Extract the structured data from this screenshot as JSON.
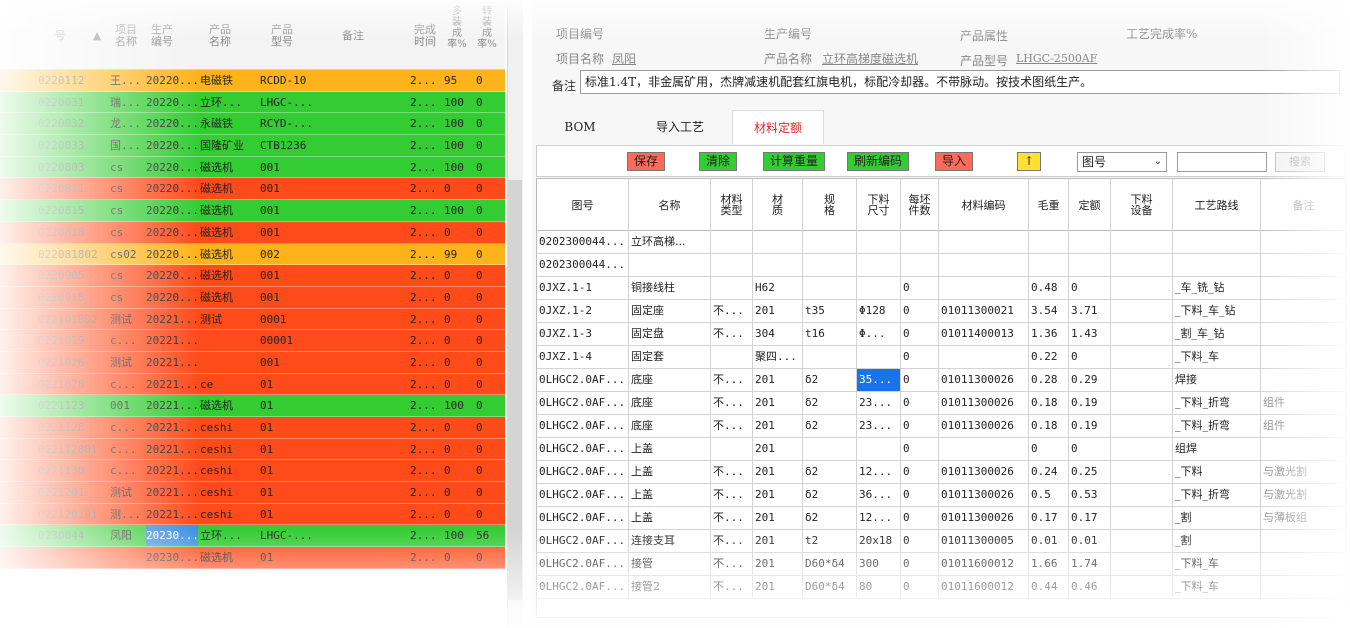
{
  "left_list": {
    "headers": [
      "号",
      "项目\n名称",
      "生产\n编号",
      "产品\n名称",
      "产品\n型号",
      "备注",
      "完成\n时间",
      "多\n装\n成\n率%",
      "转\n装\n成\n率%"
    ],
    "rows": [
      {
        "code": "0220112",
        "name": "王...",
        "prod_no": "20220...",
        "product": "电磁铁",
        "model": "RCDD-10",
        "remark": "",
        "time": "2...",
        "r1": "95",
        "r2": "0",
        "color": "#ffb31a"
      },
      {
        "code": "0220031",
        "name": "瑞...",
        "prod_no": "20220...",
        "product": "立环...",
        "model": "LHGC-...",
        "remark": "",
        "time": "2...",
        "r1": "100",
        "r2": "0",
        "color": "#33cc33"
      },
      {
        "code": "0220032",
        "name": "龙...",
        "prod_no": "20220...",
        "product": "永磁铁",
        "model": "RCYD-...",
        "remark": "",
        "time": "2...",
        "r1": "100",
        "r2": "0",
        "color": "#33cc33"
      },
      {
        "code": "0220033",
        "name": "国...",
        "prod_no": "20220...",
        "product": "国隆矿业",
        "model": "CTB1236",
        "remark": "",
        "time": "2...",
        "r1": "100",
        "r2": "0",
        "color": "#33cc33"
      },
      {
        "code": "0220803",
        "name": "cs",
        "prod_no": "20220...",
        "product": "磁选机",
        "model": "001",
        "remark": "",
        "time": "2...",
        "r1": "100",
        "r2": "0",
        "color": "#33cc33"
      },
      {
        "code": "0220811",
        "name": "cs",
        "prod_no": "20220...",
        "product": "磁选机",
        "model": "001",
        "remark": "",
        "time": "2...",
        "r1": "0",
        "r2": "0",
        "color": "#ff4a1a"
      },
      {
        "code": "0220815",
        "name": "cs",
        "prod_no": "20220...",
        "product": "磁选机",
        "model": "001",
        "remark": "",
        "time": "2...",
        "r1": "100",
        "r2": "0",
        "color": "#33cc33"
      },
      {
        "code": "0220818",
        "name": "cs",
        "prod_no": "20220...",
        "product": "磁选机",
        "model": "001",
        "remark": "",
        "time": "2...",
        "r1": "0",
        "r2": "0",
        "color": "#ff4a1a"
      },
      {
        "code": "022081802",
        "name": "cs02",
        "prod_no": "20220...",
        "product": "磁选机",
        "model": "002",
        "remark": "",
        "time": "2...",
        "r1": "99",
        "r2": "0",
        "color": "#ffb31a"
      },
      {
        "code": "0220905",
        "name": "cs",
        "prod_no": "20220...",
        "product": "磁选机",
        "model": "001",
        "remark": "",
        "time": "2...",
        "r1": "0",
        "r2": "0",
        "color": "#ff4a1a"
      },
      {
        "code": "0220915",
        "name": "cs",
        "prod_no": "20220...",
        "product": "磁选机",
        "model": "001",
        "remark": "",
        "time": "2...",
        "r1": "0",
        "r2": "0",
        "color": "#ff4a1a"
      },
      {
        "code": "022101802",
        "name": "测试",
        "prod_no": "20221...",
        "product": "测试",
        "model": "0001",
        "remark": "",
        "time": "2...",
        "r1": "0",
        "r2": "0",
        "color": "#ff4a1a"
      },
      {
        "code": "0221019",
        "name": "c...",
        "prod_no": "20221...",
        "product": "",
        "model": "00001",
        "remark": "",
        "time": "2...",
        "r1": "0",
        "r2": "0",
        "color": "#ff4a1a"
      },
      {
        "code": "0221026",
        "name": "测试",
        "prod_no": "20221...",
        "product": "",
        "model": "001",
        "remark": "",
        "time": "2...",
        "r1": "0",
        "r2": "0",
        "color": "#ff4a1a"
      },
      {
        "code": "0221028",
        "name": "c...",
        "prod_no": "20221...",
        "product": "ce",
        "model": "01",
        "remark": "",
        "time": "2...",
        "r1": "0",
        "r2": "0",
        "color": "#ff4a1a"
      },
      {
        "code": "0221123",
        "name": "001",
        "prod_no": "20221...",
        "product": "磁选机",
        "model": "01",
        "remark": "",
        "time": "2...",
        "r1": "100",
        "r2": "0",
        "color": "#33cc33"
      },
      {
        "code": "0221128",
        "name": "c...",
        "prod_no": "20221...",
        "product": "ceshi",
        "model": "01",
        "remark": "",
        "time": "2...",
        "r1": "0",
        "r2": "0",
        "color": "#ff4a1a"
      },
      {
        "code": "022112801",
        "name": "c...",
        "prod_no": "20221...",
        "product": "ceshi",
        "model": "01",
        "remark": "",
        "time": "2...",
        "r1": "0",
        "r2": "0",
        "color": "#ff4a1a"
      },
      {
        "code": "0221130",
        "name": "c...",
        "prod_no": "20221...",
        "product": "ceshi",
        "model": "01",
        "remark": "",
        "time": "2...",
        "r1": "0",
        "r2": "0",
        "color": "#ff4a1a"
      },
      {
        "code": "0221201",
        "name": "测试",
        "prod_no": "20221...",
        "product": "ceshi",
        "model": "01",
        "remark": "",
        "time": "2...",
        "r1": "0",
        "r2": "0",
        "color": "#ff4a1a"
      },
      {
        "code": "022120101",
        "name": "测...",
        "prod_no": "20221...",
        "product": "ceshi",
        "model": "01",
        "remark": "",
        "time": "2...",
        "r1": "0",
        "r2": "0",
        "color": "#ff4a1a"
      },
      {
        "code": "0230044",
        "name": "凤阳",
        "prod_no": "20230...",
        "product": "立环...",
        "model": "LHGC-...",
        "remark": "",
        "time": "2...",
        "r1": "100",
        "r2": "56",
        "color": "#33cc33",
        "selected": true
      },
      {
        "code": "",
        "name": "",
        "prod_no": "20230...",
        "product": "磁选机",
        "model": "01",
        "remark": "",
        "time": "2...",
        "r1": "0",
        "r2": "0",
        "color": "#ff4a1a"
      }
    ]
  },
  "header_info": {
    "project_no_label": "项目编号",
    "project_name_label": "项目名称",
    "project_name": "凤阳",
    "prod_no_label": "生产编号",
    "product_name_label": "产品名称",
    "product_name": "立环高梯度磁选机",
    "product_attr_label": "产品属性",
    "product_model_label": "产品型号",
    "product_model": "LHGC-2500AF",
    "process_rate_label": "工艺完成率%"
  },
  "remark": {
    "label": "备注",
    "text": "标准1.4T，非金属矿用，杰牌减速机配套红旗电机，标配冷却器。不带脉动。按技术图纸生产。"
  },
  "tabs": [
    {
      "label": "BOM",
      "active": false
    },
    {
      "label": "导入工艺",
      "active": false
    },
    {
      "label": "材料定额",
      "active": true
    }
  ],
  "toolbar": {
    "save": "保存",
    "clear": "清除",
    "calc_weight": "计算重量",
    "refresh_code": "刷新编码",
    "import": "导入",
    "up_arrow": "↑",
    "field_select": "图号",
    "search": "搜索"
  },
  "grid": {
    "headers": [
      "图号",
      "名称",
      "材料\n类型",
      "材\n质",
      "规\n格",
      "下料\n尺寸",
      "每坯\n件数",
      "材料编码",
      "毛重",
      "定额",
      "下料\n设备",
      "工艺路线",
      "备注"
    ],
    "rows": [
      [
        "0202300044...",
        "立环高梯...",
        "",
        "",
        "",
        "",
        "",
        "",
        "",
        "",
        "",
        "",
        ""
      ],
      [
        "0202300044...",
        "",
        "",
        "",
        "",
        "",
        "",
        "",
        "",
        "",
        "",
        "",
        ""
      ],
      [
        "0JXZ.1-1",
        "铜接线柱",
        "",
        "H62",
        "",
        "",
        "0",
        "",
        "0.48",
        "0",
        "",
        "_车_铣_钻",
        ""
      ],
      [
        "0JXZ.1-2",
        "固定座",
        "不...",
        "201",
        "t35",
        "Φ128",
        "0",
        "01011300021",
        "3.54",
        "3.71",
        "",
        "_下料_车_钻",
        ""
      ],
      [
        "0JXZ.1-3",
        "固定盘",
        "不...",
        "304",
        "t16",
        "Φ...",
        "0",
        "01011400013",
        "1.36",
        "1.43",
        "",
        "_割_车_钻",
        ""
      ],
      [
        "0JXZ.1-4",
        "固定套",
        "",
        "聚四...",
        "",
        "",
        "0",
        "",
        "0.22",
        "0",
        "",
        "_下料_车",
        ""
      ],
      [
        "0LHGC2.0AF...",
        "底座",
        "不...",
        "201",
        "δ2",
        "35...",
        "0",
        "01011300026",
        "0.28",
        "0.29",
        "",
        "焊接",
        ""
      ],
      [
        "0LHGC2.0AF...",
        "底座",
        "不...",
        "201",
        "δ2",
        "23...",
        "0",
        "01011300026",
        "0.18",
        "0.19",
        "",
        "_下料_折弯",
        "组件"
      ],
      [
        "0LHGC2.0AF...",
        "底座",
        "不...",
        "201",
        "δ2",
        "23...",
        "0",
        "01011300026",
        "0.18",
        "0.19",
        "",
        "_下料_折弯",
        "组件"
      ],
      [
        "0LHGC2.0AF...",
        "上盖",
        "",
        "201",
        "",
        "",
        "0",
        "",
        "0",
        "0",
        "",
        "组焊",
        ""
      ],
      [
        "0LHGC2.0AF...",
        "上盖",
        "不...",
        "201",
        "δ2",
        "12...",
        "0",
        "01011300026",
        "0.24",
        "0.25",
        "",
        "_下料",
        "与激光割"
      ],
      [
        "0LHGC2.0AF...",
        "上盖",
        "不...",
        "201",
        "δ2",
        "36...",
        "0",
        "01011300026",
        "0.5",
        "0.53",
        "",
        "_下料_折弯",
        "与激光割"
      ],
      [
        "0LHGC2.0AF...",
        "上盖",
        "不...",
        "201",
        "δ2",
        "12...",
        "0",
        "01011300026",
        "0.17",
        "0.17",
        "",
        "_割",
        "与薄板组"
      ],
      [
        "0LHGC2.0AF...",
        "连接支耳",
        "不...",
        "201",
        "t2",
        "20x18",
        "0",
        "01011300005",
        "0.01",
        "0.01",
        "",
        "_割",
        ""
      ],
      [
        "0LHGC2.0AF...",
        "接管",
        "不...",
        "201",
        "D60*δ4",
        "300",
        "0",
        "01011600012",
        "1.66",
        "1.74",
        "",
        "_下料_车",
        ""
      ],
      [
        "0LHGC2.0AF...",
        "接管2",
        "不...",
        "201",
        "D60*δ4",
        "80",
        "0",
        "01011600012",
        "0.44",
        "0.46",
        "",
        "_下料_车",
        ""
      ]
    ]
  },
  "colors": {
    "orange": "#ffb31a",
    "green": "#33cc33",
    "red": "#ff4a1a",
    "selection": "#1a73e8"
  }
}
